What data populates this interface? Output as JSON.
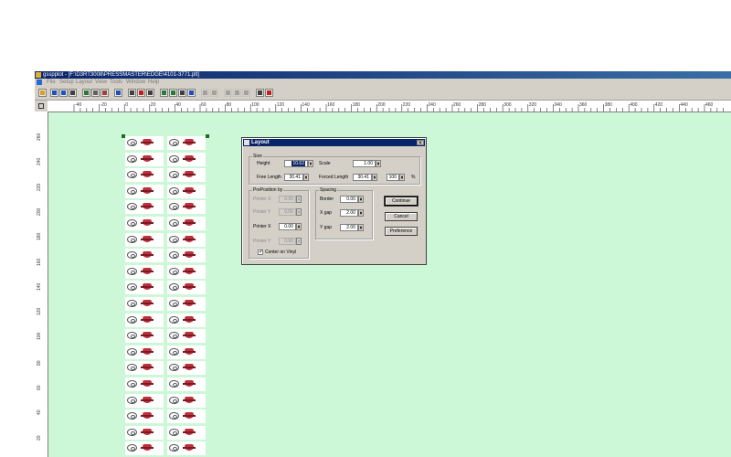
{
  "window": {
    "title": "gsspplot - [F:\\D3RT3008\\PRESSMASTER\\EDGE\\4101-3771.plt]"
  },
  "menubar": {
    "items": [
      "File",
      "Setup",
      "Layout",
      "View",
      "Tools",
      "Window",
      "Help"
    ]
  },
  "hruler": {
    "ticks": [
      "-40",
      "-20",
      "0",
      "20",
      "40",
      "60",
      "80",
      "100",
      "120",
      "140",
      "160",
      "180",
      "200",
      "220",
      "240",
      "260",
      "280",
      "300",
      "320",
      "340",
      "360",
      "380",
      "400",
      "420",
      "440",
      "460"
    ]
  },
  "vruler": {
    "ticks": [
      "260",
      "240",
      "220",
      "200",
      "180",
      "160",
      "140",
      "120",
      "100",
      "80",
      "60",
      "40",
      "20"
    ]
  },
  "dialog": {
    "title": "Layout",
    "close_glyph": "✕",
    "size": {
      "group_label": "Size",
      "height_label": "Height",
      "height_value": "10.62",
      "scale_label": "Scale",
      "scale_value": "1.00",
      "free_length_label": "Free Length",
      "free_length_value": "30.41",
      "forced_length_label": "Forced Length",
      "forced_length_value": "30.41",
      "percent_value": "100",
      "percent_unit": "%"
    },
    "preposition": {
      "group_label": "PrePosition by",
      "printer_x1_label": "Printer X",
      "printer_x1_value": "0.00",
      "printer_y1_label": "Printer Y",
      "printer_y1_value": "0.00",
      "printer_x2_label": "Printer X",
      "printer_x2_value": "0.00",
      "printer_y2_label": "Printer Y",
      "printer_y2_value": "0.00",
      "center_label": "Center on Vinyl",
      "center_checked": "✓"
    },
    "spacing": {
      "group_label": "Spacing",
      "border_label": "Border",
      "border_value": "0.00",
      "xgap_label": "X gap",
      "xgap_value": "2.00",
      "ygap_label": "Y gap",
      "ygap_value": "2.00"
    },
    "buttons": {
      "continue": "Continue",
      "cancel": "Cancel",
      "preference": "Preference"
    }
  },
  "colors": {
    "canvas": "#ccf8d8",
    "titlebar": "#0a246a"
  }
}
